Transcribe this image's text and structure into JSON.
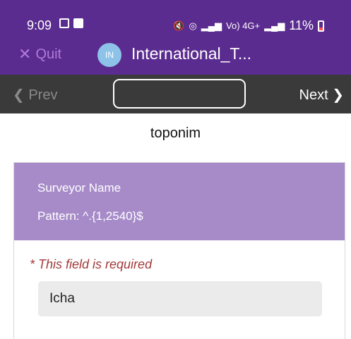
{
  "status_bar": {
    "time": "9:09",
    "network_text": "Vo) 4G+",
    "battery_percent": "11%"
  },
  "app_header": {
    "quit_label": "Quit",
    "avatar_initials": "IN",
    "form_title": "International_T..."
  },
  "nav": {
    "prev_label": "Prev",
    "next_label": "Next",
    "jump_value": ""
  },
  "group": {
    "title": "toponim"
  },
  "question": {
    "label": "Surveyor Name",
    "hint": "Pattern: ^.{1,2540}$",
    "required_message": "* This field is required",
    "answer_value": "Icha"
  },
  "colors": {
    "header": "#5b2c8f",
    "navbar": "#3a3a3a",
    "question_header": "#a78bc9",
    "required_text": "#a23a3a"
  }
}
